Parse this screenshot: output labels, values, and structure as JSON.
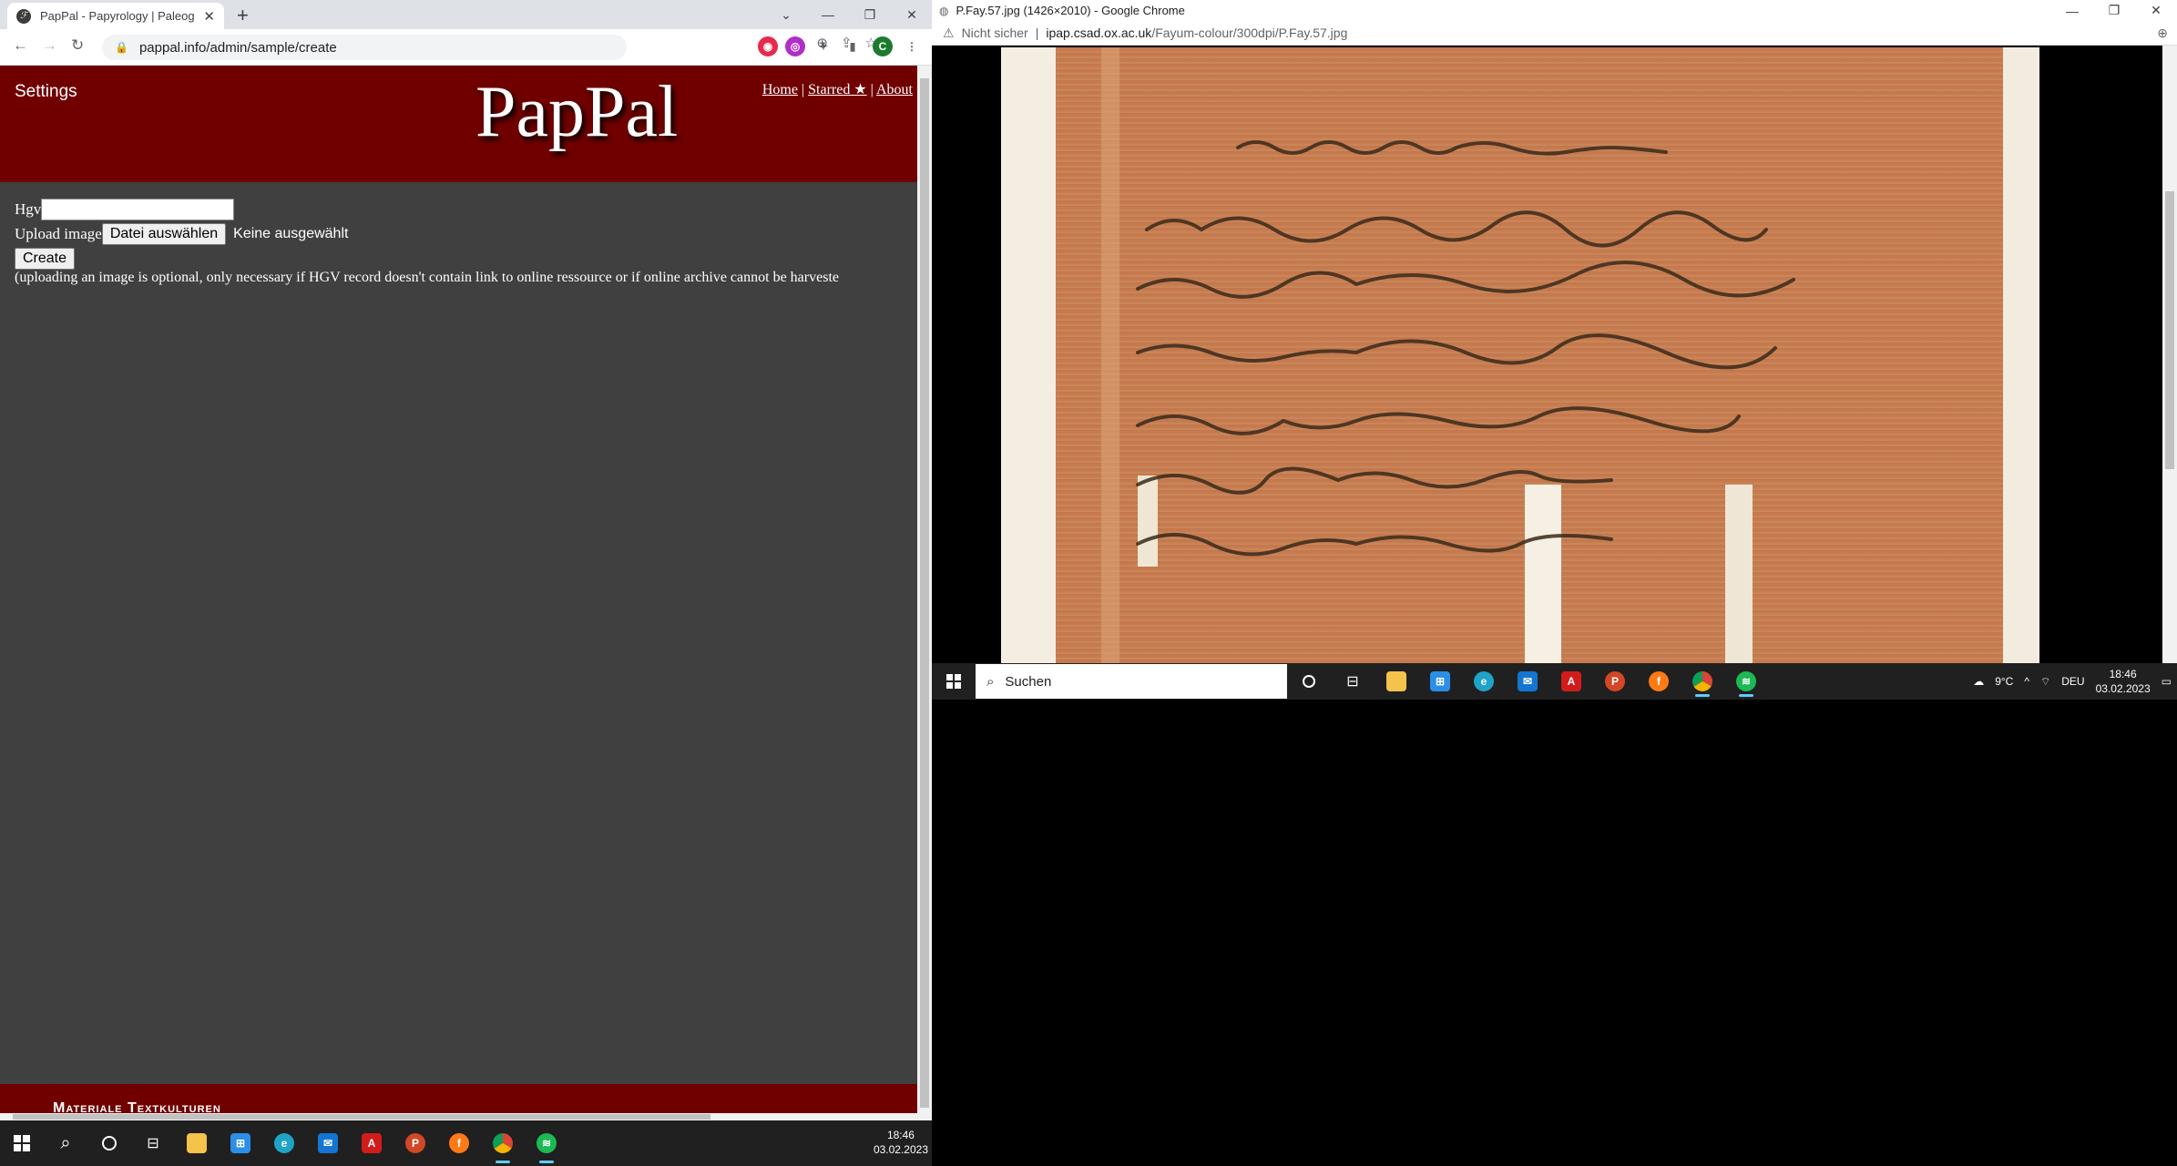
{
  "left_browser": {
    "tab_title": "PapPal - Papyrology | Paleography",
    "url": "pappal.info/admin/sample/create",
    "profile_initial": "C"
  },
  "page": {
    "settings": "Settings",
    "logo": "PapPal",
    "nav": {
      "home": "Home",
      "sep1": "|",
      "starred": "Starred ★",
      "sep2": "|",
      "about": "About"
    },
    "form": {
      "hgv_label": "Hgv",
      "hgv_value": "",
      "upload_label": "Upload image",
      "choose_file": "Datei auswählen",
      "no_file": "Keine ausgewählt",
      "create": "Create"
    },
    "note": "(uploading an image is optional, only necessary if HGV record doesn't contain link to online ressource or if online archive cannot be harveste",
    "footer": "Materiale Textkulturen"
  },
  "right_browser": {
    "title": "P.Fay.57.jpg (1426×2010) - Google Chrome",
    "security": "Nicht sicher",
    "url_host": "ipap.csad.ox.ac.uk",
    "url_path": "/Fayum-colour/300dpi/P.Fay.57.jpg"
  },
  "right_taskbar": {
    "search_placeholder": "Suchen",
    "weather": "9°C",
    "lang": "DEU",
    "time": "18:46",
    "date": "03.02.2023"
  },
  "bottom_taskbar": {
    "time": "18:46",
    "date": "03.02.2023"
  },
  "colors": {
    "header": "#700000",
    "page_bg": "#404040",
    "papyrus": "#c8794e"
  }
}
